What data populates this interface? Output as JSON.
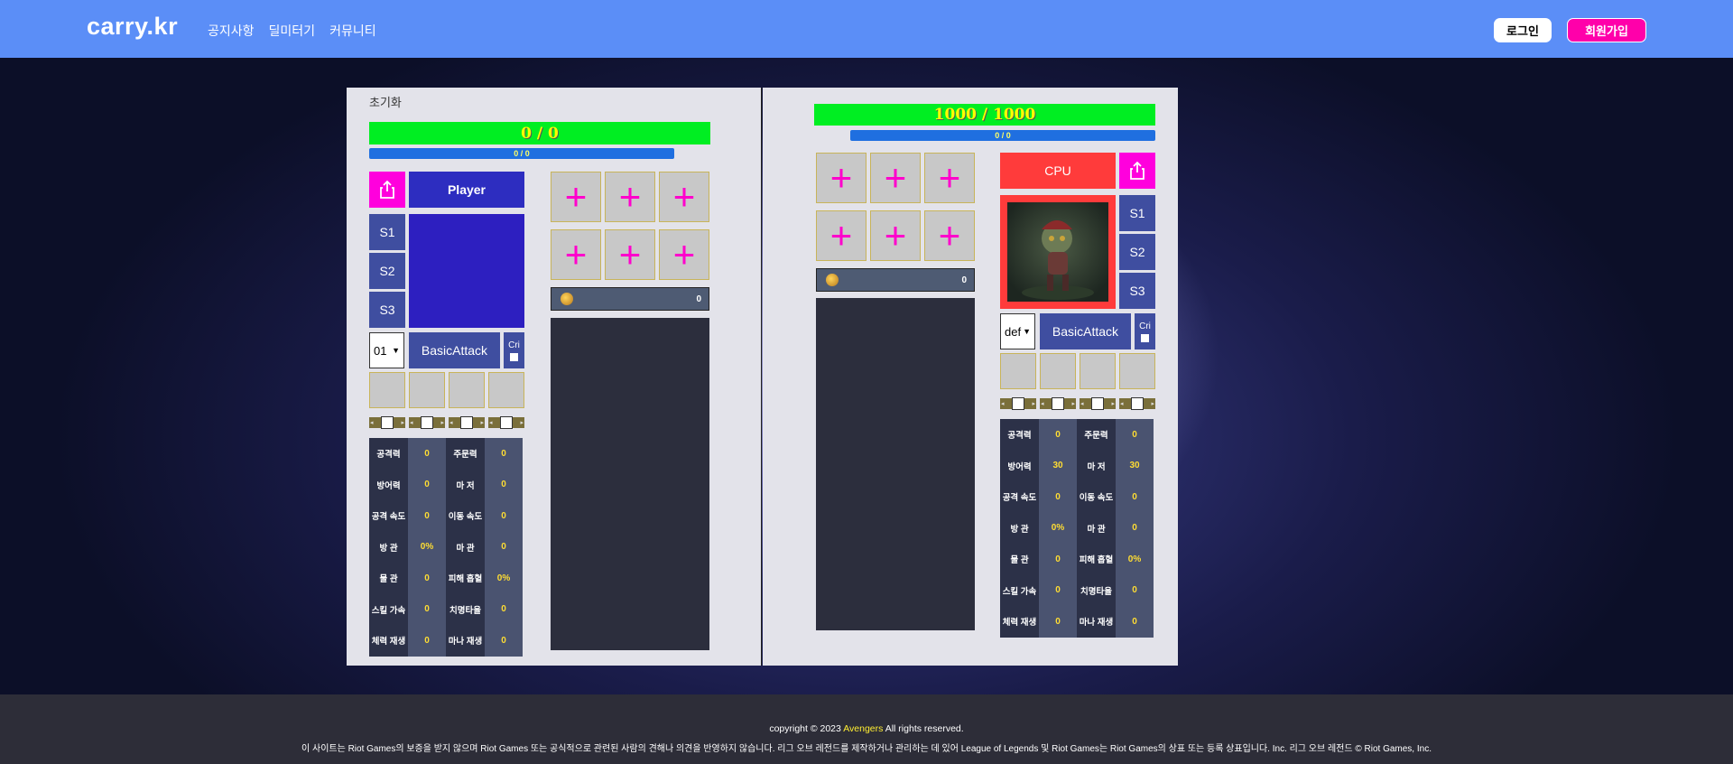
{
  "header": {
    "brand": "carry.kr",
    "nav": [
      "공지사항",
      "딜미터기",
      "커뮤니티"
    ],
    "login_label": "로그인",
    "signup_label": "회원가입",
    "bg_color": "#5b8ef7"
  },
  "left": {
    "reset_label": "초기화",
    "hp": "0 / 0",
    "mp": "0 / 0",
    "name": "Player",
    "skills": [
      "S1",
      "S2",
      "S3"
    ],
    "level_select": "01",
    "basic_attack": "BasicAttack",
    "cri_label": "Cri",
    "gold_value": "0",
    "stats": [
      [
        "공격력",
        "0",
        "주문력",
        "0"
      ],
      [
        "방어력",
        "0",
        "마 저",
        "0"
      ],
      [
        "공격 속도",
        "0",
        "이동 속도",
        "0"
      ],
      [
        "방 관",
        "0%",
        "마 관",
        "0"
      ],
      [
        "물 관",
        "0",
        "피해 흡혈",
        "0%"
      ],
      [
        "스킬 가속",
        "0",
        "치명타율",
        "0"
      ],
      [
        "체력 재생",
        "0",
        "마나 재생",
        "0"
      ]
    ]
  },
  "right": {
    "hp": "1000 / 1000",
    "mp": "0 / 0",
    "name": "CPU",
    "skills": [
      "S1",
      "S2",
      "S3"
    ],
    "def_select": "def",
    "basic_attack": "BasicAttack",
    "cri_label": "Cri",
    "gold_value": "0",
    "stats": [
      [
        "공격력",
        "0",
        "주문력",
        "0"
      ],
      [
        "방어력",
        "30",
        "마 저",
        "30"
      ],
      [
        "공격 속도",
        "0",
        "이동 속도",
        "0"
      ],
      [
        "방 관",
        "0%",
        "마 관",
        "0"
      ],
      [
        "물 관",
        "0",
        "피해 흡혈",
        "0%"
      ],
      [
        "스킬 가속",
        "0",
        "치명타율",
        "0"
      ],
      [
        "체력 재생",
        "0",
        "마나 재생",
        "0"
      ]
    ]
  },
  "icons": {
    "plus": "+",
    "share": "share-icon",
    "coin": "gold-coin-icon",
    "dropdown": "chevron-down-icon"
  },
  "footer": {
    "copyright_prefix": "copyright © 2023",
    "copyright_team": "Avengers",
    "copyright_suffix": "All rights reserved.",
    "disclaimer": "이 사이트는 Riot Games의 보증을 받지 않으며 Riot Games 또는 공식적으로 관련된 사람의 견해나 의견을 반영하지 않습니다. 리그 오브 레전드를 제작하거나 관리하는 데 있어 League of Legends 및 Riot Games는 Riot Games의 상표 또는 등록 상표입니다. Inc. 리그 오브 레전드 © Riot Games, Inc."
  }
}
